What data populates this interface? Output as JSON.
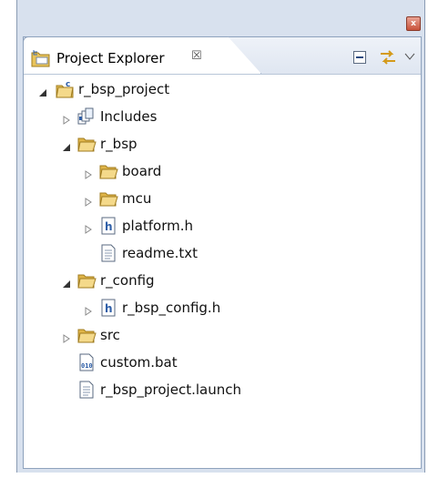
{
  "view": {
    "title": "Project Explorer",
    "close_glyph": "☒",
    "window_close_glyph": "x"
  },
  "toolbar": {
    "collapse_icon": "collapse-all-icon",
    "link_icon": "link-with-editor-icon",
    "menu_icon": "view-menu-icon"
  },
  "tree": {
    "items": [
      {
        "label": "r_bsp_project",
        "icon": "c-project-icon",
        "expander": "expanded"
      },
      {
        "label": "Includes",
        "icon": "includes-icon",
        "expander": "collapsed"
      },
      {
        "label": "r_bsp",
        "icon": "folder-icon",
        "expander": "expanded"
      },
      {
        "label": "board",
        "icon": "folder-icon",
        "expander": "collapsed"
      },
      {
        "label": "mcu",
        "icon": "folder-icon",
        "expander": "collapsed"
      },
      {
        "label": "platform.h",
        "icon": "header-file-icon",
        "expander": "collapsed"
      },
      {
        "label": "readme.txt",
        "icon": "text-file-icon",
        "expander": "none"
      },
      {
        "label": "r_config",
        "icon": "folder-icon",
        "expander": "expanded"
      },
      {
        "label": "r_bsp_config.h",
        "icon": "header-file-icon",
        "expander": "collapsed"
      },
      {
        "label": "src",
        "icon": "folder-icon",
        "expander": "collapsed"
      },
      {
        "label": "custom.bat",
        "icon": "binary-file-icon",
        "expander": "none"
      },
      {
        "label": "r_bsp_project.launch",
        "icon": "text-file-icon",
        "expander": "none"
      }
    ]
  },
  "colors": {
    "folder": "#e8c35a",
    "header_icon": "#2f5fa8",
    "panel_border": "#8ea2bd",
    "window_bg": "#d8e1ee"
  }
}
